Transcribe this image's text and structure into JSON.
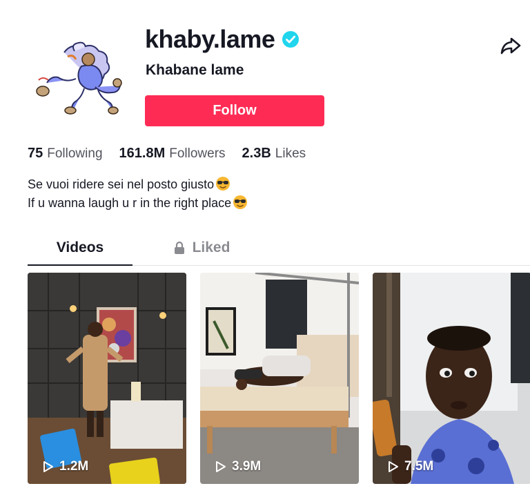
{
  "profile": {
    "username": "khaby.lame",
    "display_name": "Khabane lame",
    "follow_label": "Follow",
    "verified": true
  },
  "stats": {
    "following": {
      "value": "75",
      "label": "Following"
    },
    "followers": {
      "value": "161.8M",
      "label": "Followers"
    },
    "likes": {
      "value": "2.3B",
      "label": "Likes"
    }
  },
  "bio": {
    "line1": "Se vuoi ridere sei nel posto giusto",
    "line2": "If u wanna laugh u r in the right place"
  },
  "tabs": [
    {
      "label": "Videos",
      "active": true
    },
    {
      "label": "Liked",
      "active": false,
      "locked": true
    }
  ],
  "videos": [
    {
      "views": "1.2M"
    },
    {
      "views": "3.9M"
    },
    {
      "views": "7.5M"
    }
  ],
  "colors": {
    "accent": "#fe2c55",
    "verified": "#20d5ec",
    "text": "#161823"
  },
  "icons": [
    "verified-badge-icon",
    "share-icon",
    "lock-icon",
    "play-icon",
    "sunglasses-emoji"
  ]
}
